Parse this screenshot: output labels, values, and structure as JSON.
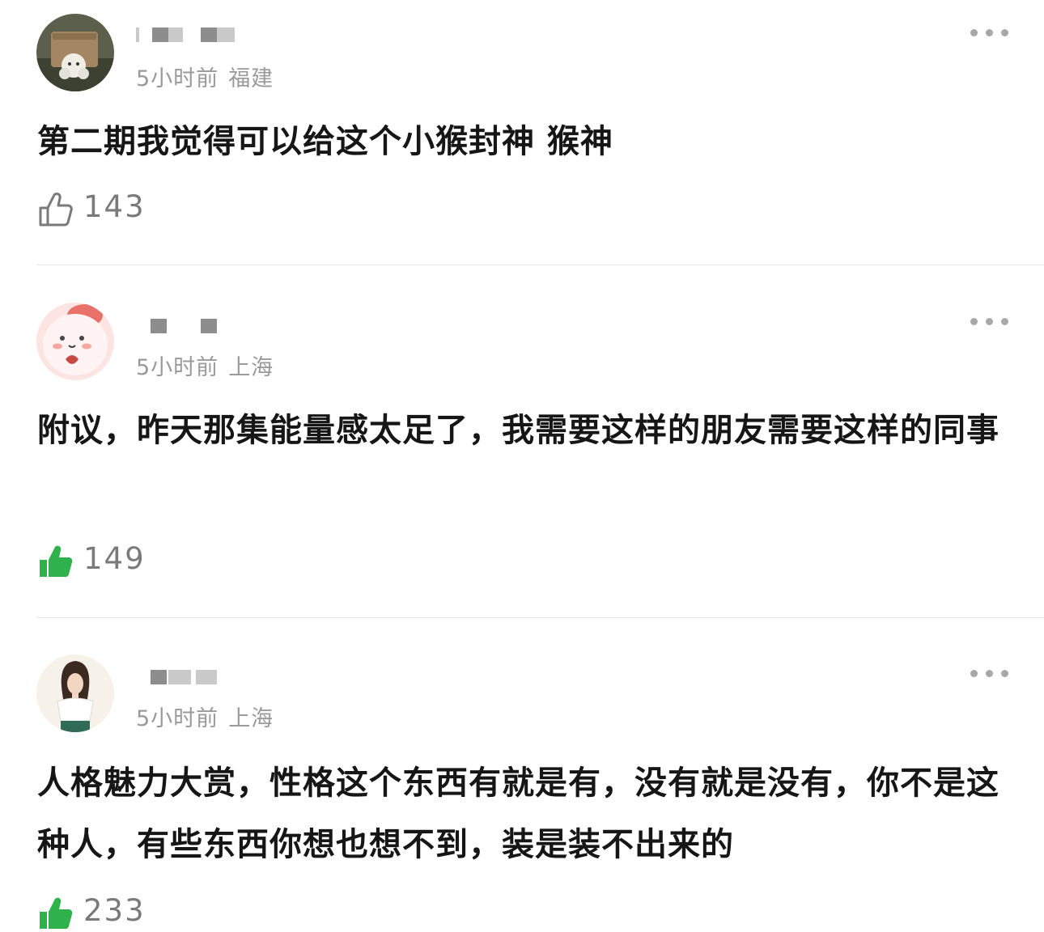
{
  "comments": [
    {
      "time": "5小时前",
      "location": "福建",
      "text": "第二期我觉得可以给这个小猴封神 猴神",
      "likes": "143",
      "liked": false
    },
    {
      "time": "5小时前",
      "location": "上海",
      "text": "附议，昨天那集能量感太足了，我需要这样的朋友需要这样的同事",
      "likes": "149",
      "liked": true
    },
    {
      "time": "5小时前",
      "location": "上海",
      "text": "人格魅力大赏，性格这个东西有就是有，没有就是没有，你不是这种人，有些东西你想也想不到，装是装不出来的",
      "likes": "233",
      "liked": true
    }
  ],
  "colors": {
    "liked_green": "#2fb24b",
    "meta_gray": "#9a9a9a",
    "count_gray": "#7a7a7a"
  },
  "icons": {
    "like_outline": "thumbs-up-outline-icon",
    "like_filled": "thumbs-up-filled-icon",
    "more": "more-dots-icon"
  }
}
